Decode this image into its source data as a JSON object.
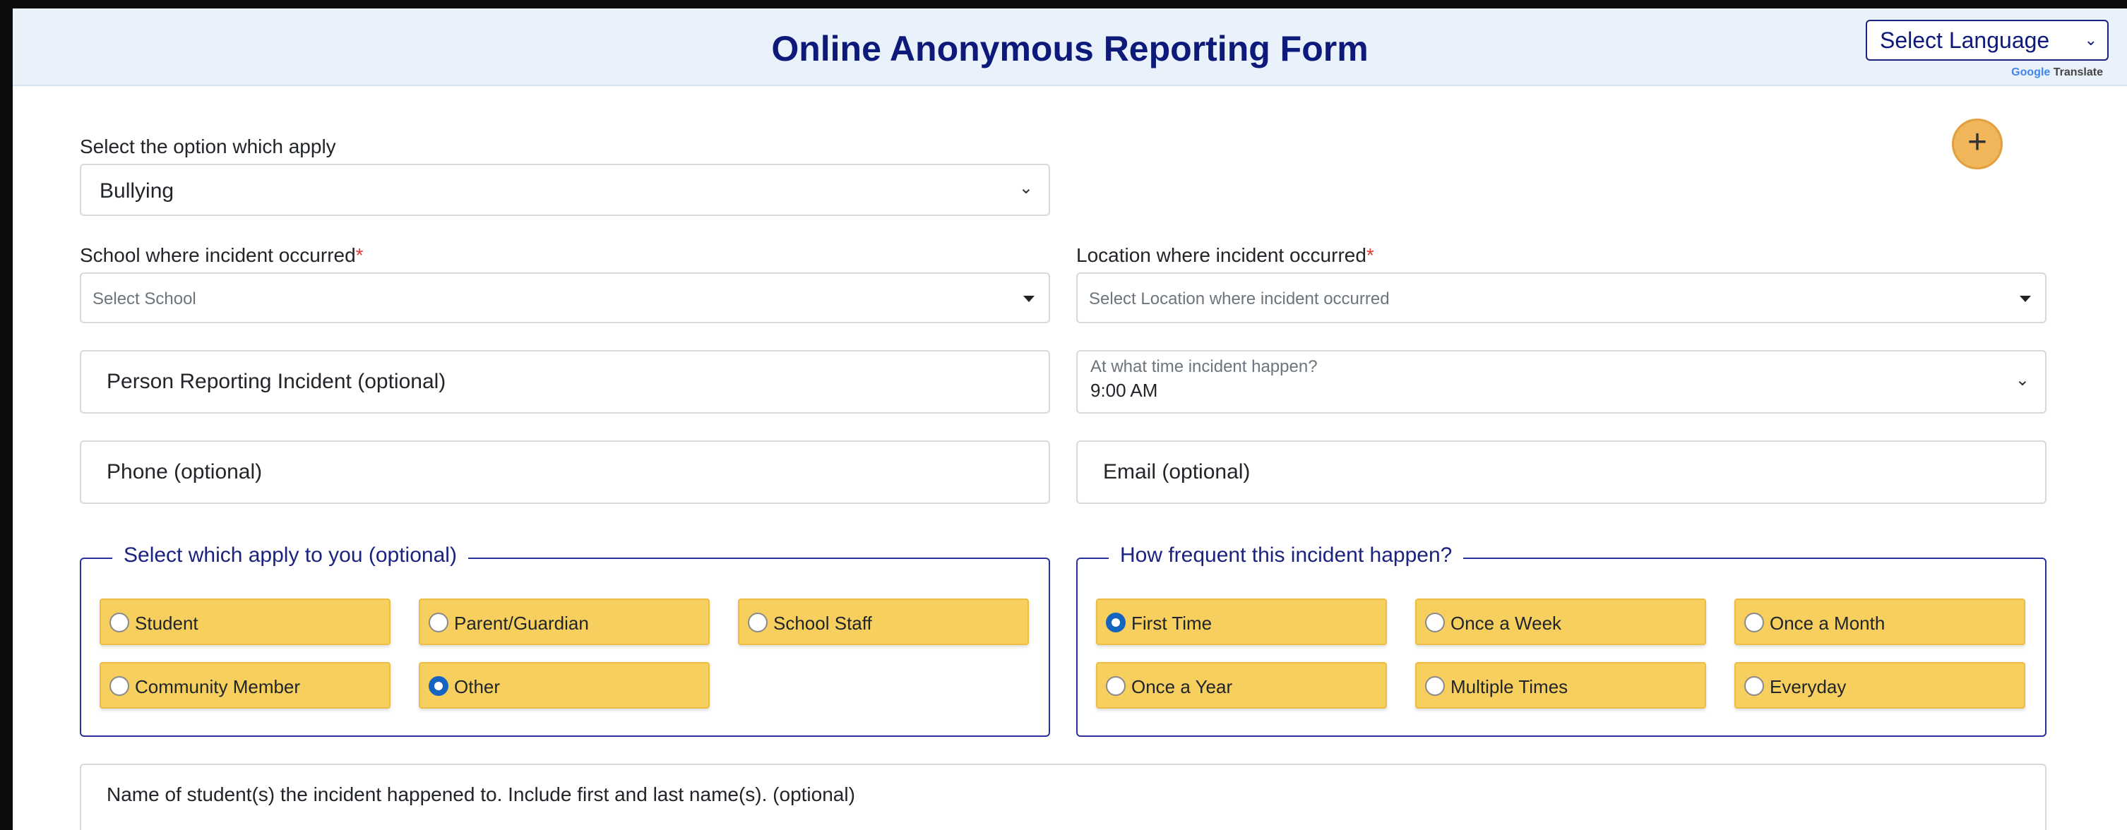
{
  "header": {
    "title": "Online Anonymous Reporting Form",
    "language_select": "Select Language",
    "powered_brand": "Google",
    "powered_text": "Translate"
  },
  "form": {
    "option_label": "Select the option which apply",
    "option_value": "Bullying",
    "school_label": "School where incident occurred",
    "school_placeholder": "Select School",
    "location_label": "Location where incident occurred",
    "location_placeholder": "Select Location where incident occurred",
    "required_mark": "*",
    "person_reporting_placeholder": "Person Reporting Incident (optional)",
    "time_label": "At what time incident happen?",
    "time_value": "9:00 AM",
    "phone_placeholder": "Phone (optional)",
    "email_placeholder": "Email (optional)",
    "student_names_placeholder": "Name of student(s) the incident happened to. Include first and last name(s). (optional)",
    "add_button": "+"
  },
  "applies_to": {
    "legend": "Select which apply to you (optional)",
    "options": [
      {
        "label": "Student",
        "selected": false
      },
      {
        "label": "Parent/Guardian",
        "selected": false
      },
      {
        "label": "School Staff",
        "selected": false
      },
      {
        "label": "Community Member",
        "selected": false
      },
      {
        "label": "Other",
        "selected": true
      }
    ]
  },
  "frequency": {
    "legend": "How frequent this incident happen?",
    "options": [
      {
        "label": "First Time",
        "selected": true
      },
      {
        "label": "Once a Week",
        "selected": false
      },
      {
        "label": "Once a Month",
        "selected": false
      },
      {
        "label": "Once a Year",
        "selected": false
      },
      {
        "label": "Multiple Times",
        "selected": false
      },
      {
        "label": "Everyday",
        "selected": false
      }
    ]
  },
  "colors": {
    "title": "#0d1a7a",
    "header_bg": "#e9f1fb",
    "option_bg": "#f7cf5e",
    "fieldset_border": "#2b2fa0",
    "add_button": "#f2b65a",
    "radio_selected": "#1565c0"
  },
  "icons": {
    "dropdown": "chevron-down-icon",
    "caret": "caret-down-icon",
    "add": "plus-icon"
  }
}
